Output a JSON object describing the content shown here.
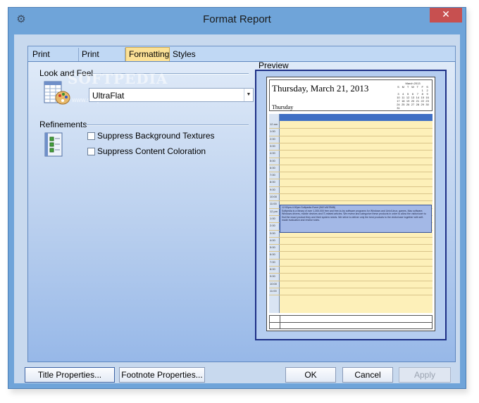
{
  "window": {
    "title": "Format Report",
    "close_glyph": "✕",
    "system_icon": "gear-icon"
  },
  "tabs": [
    {
      "label": "Print Ranges",
      "active": false
    },
    {
      "label": "Print Styles",
      "active": false
    },
    {
      "label": "Formatting",
      "active": true
    },
    {
      "label": "Styles",
      "active": false
    }
  ],
  "look_and_feel": {
    "group_label": "Look and Feel",
    "selected_value": "UltraFlat",
    "icon": "palette-document-icon",
    "watermark": "SOFTPEDIA",
    "watermark_sub": "www.softpedia.com"
  },
  "refinements": {
    "group_label": "Refinements",
    "icon": "checklist-icon",
    "options": [
      {
        "label": "Suppress Background Textures",
        "checked": false
      },
      {
        "label": "Suppress Content Coloration",
        "checked": false
      }
    ]
  },
  "preview": {
    "group_label": "Preview",
    "date_title": "Thursday, March 21, 2013",
    "day_label": "Thursday",
    "mini_calendar": {
      "title": "March 2013",
      "weekdays": [
        "S",
        "M",
        "T",
        "W",
        "T",
        "F",
        "S"
      ],
      "weeks": [
        [
          "",
          "",
          "",
          "",
          "",
          "1",
          "2"
        ],
        [
          "3",
          "4",
          "5",
          "6",
          "7",
          "8",
          "9"
        ],
        [
          "10",
          "11",
          "12",
          "13",
          "14",
          "15",
          "16"
        ],
        [
          "17",
          "18",
          "19",
          "20",
          "21",
          "22",
          "23"
        ],
        [
          "24",
          "25",
          "26",
          "27",
          "28",
          "29",
          "30"
        ],
        [
          "31",
          "",
          "",
          "",
          "",
          "",
          ""
        ]
      ]
    },
    "time_labels": [
      "12 am",
      "1:00",
      "2:00",
      "3:00",
      "4:00",
      "5:00",
      "6:00",
      "7:00",
      "8:00",
      "9:00",
      "10:00",
      "11:00",
      "12 pm",
      "1:00",
      "2:00",
      "3:00",
      "4:00",
      "5:00",
      "6:00",
      "7:00",
      "8:00",
      "9:00",
      "10:00",
      "11:00"
    ],
    "appointment": {
      "title": "12:00pm-4:00pm Softpedia Event (5621A57B6B)",
      "body": "Softpedia is a library of over 1,300,000 free and free-to-try software programs for Windows and Unix/Linux, games, Mac software, Windows drivers, mobile devices and IT-related articles. We review and categorize these products in order to allow the visitor/user to find the exact product they and their system needs. We strive to deliver only the best products to the visitor/user together with self-made evaluation and review notes."
    },
    "colors": {
      "header_bar": "#3f6fc4",
      "work_area": "#fdf0b9",
      "appointment": "#a3b8e6"
    }
  },
  "buttons": {
    "title_properties": "Title Properties...",
    "footnote_properties": "Footnote Properties...",
    "ok": "OK",
    "cancel": "Cancel",
    "apply": "Apply"
  }
}
